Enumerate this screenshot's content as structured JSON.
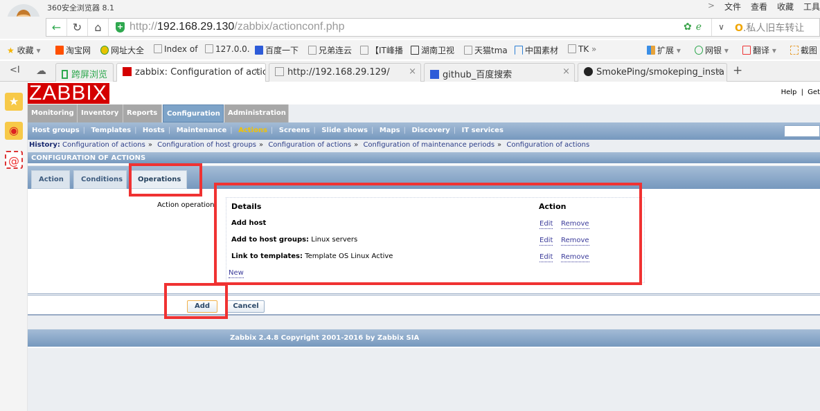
{
  "browser": {
    "app_title": "360安全浏览器 8.1",
    "menu": [
      "文件",
      "查看",
      "收藏",
      "工具"
    ],
    "menu_arrow": ">",
    "url_prefix": "http://",
    "url_host": "192.168.29.130",
    "url_path": "/zabbix/actionconf.php",
    "search_hint": "私人旧车转让",
    "bookmarks": [
      {
        "label": "收藏",
        "icon": "star-icon"
      },
      {
        "label": "淘宝网",
        "icon": "taobao-icon"
      },
      {
        "label": "网址大全",
        "icon": "plus-circle-icon"
      },
      {
        "label": "Index of",
        "icon": "page-icon"
      },
      {
        "label": "127.0.0.",
        "icon": "page-icon"
      },
      {
        "label": "百度一下",
        "icon": "baidu-paw-icon"
      },
      {
        "label": "兄弟连云",
        "icon": "page-icon"
      },
      {
        "label": "【IT峰播",
        "icon": "page-icon"
      },
      {
        "label": "湖南卫视",
        "icon": "tv-icon"
      },
      {
        "label": "天猫tma",
        "icon": "page-icon"
      },
      {
        "label": "中国素材",
        "icon": "bracket-icon"
      },
      {
        "label": "TK",
        "icon": "page-icon"
      }
    ],
    "bookmarks_more": "»",
    "tools": [
      {
        "label": "扩展",
        "icon": "extension-icon"
      },
      {
        "label": "网银",
        "icon": "bank-icon"
      },
      {
        "label": "翻译",
        "icon": "translate-icon"
      },
      {
        "label": "截图",
        "icon": "screenshot-icon"
      }
    ],
    "side_tab": "跨屏浏览",
    "tabs": [
      {
        "label": "zabbix: Configuration of actic",
        "active": true
      },
      {
        "label": "http://192.168.29.129/",
        "active": false
      },
      {
        "label": "github_百度搜索",
        "active": false
      },
      {
        "label": "SmokePing/smokeping_insta",
        "active": false
      }
    ],
    "new_tab": "+"
  },
  "zabbix": {
    "logo": "ZABBIX",
    "help": "Help",
    "get": "Get",
    "help_sep": "|",
    "main_menu": [
      "Monitoring",
      "Inventory",
      "Reports",
      "Configuration",
      "Administration"
    ],
    "main_menu_active": "Configuration",
    "sub_menu": [
      "Host groups",
      "Templates",
      "Hosts",
      "Maintenance",
      "Actions",
      "Screens",
      "Slide shows",
      "Maps",
      "Discovery",
      "IT services"
    ],
    "sub_menu_active": "Actions",
    "history_label": "History:",
    "history": [
      "Configuration of actions",
      "Configuration of host groups",
      "Configuration of actions",
      "Configuration of maintenance periods",
      "Configuration of actions"
    ],
    "history_sep": "»",
    "section_title": "CONFIGURATION OF ACTIONS",
    "form_tabs": [
      "Action",
      "Conditions",
      "Operations"
    ],
    "form_tab_active": "Operations",
    "operations_label": "Action operation",
    "operations_table": {
      "headers": [
        "Details",
        "Action"
      ],
      "rows": [
        {
          "label": "Add host",
          "value": "",
          "edit": "Edit",
          "remove": "Remove"
        },
        {
          "label": "Add to host groups:",
          "value": "Linux servers",
          "edit": "Edit",
          "remove": "Remove"
        },
        {
          "label": "Link to templates:",
          "value": "Template OS Linux Active",
          "edit": "Edit",
          "remove": "Remove"
        }
      ],
      "new_link": "New"
    },
    "buttons": {
      "add": "Add",
      "cancel": "Cancel"
    },
    "footer": "Zabbix 2.4.8 Copyright 2001-2016 by Zabbix SIA"
  },
  "colors": {
    "highlight": "#f03232",
    "zabbix_red": "#d40000",
    "active_submenu": "#f2c200",
    "link": "#3b3b9a"
  }
}
